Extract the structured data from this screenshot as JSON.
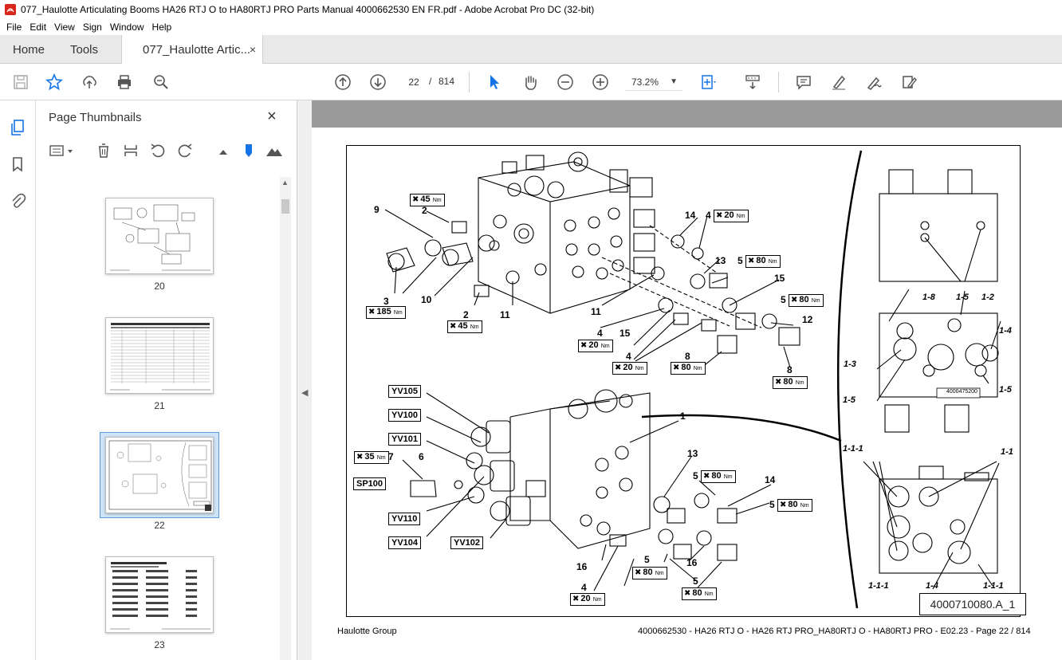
{
  "window": {
    "title": "077_Haulotte Articulating Booms HA26 RTJ O to HA80RTJ PRO Parts Manual 4000662530 EN FR.pdf - Adobe Acrobat Pro DC (32-bit)"
  },
  "menu": [
    "File",
    "Edit",
    "View",
    "Sign",
    "Window",
    "Help"
  ],
  "tabs": {
    "home": "Home",
    "tools": "Tools",
    "document": "077_Haulotte Artic...",
    "close": "×"
  },
  "toolbar": {
    "current_page": "22",
    "page_separator": "/",
    "total_pages": "814",
    "zoom": "73.2%"
  },
  "thumbnails_panel": {
    "title": "Page Thumbnails",
    "close": "×",
    "pages": [
      "20",
      "21",
      "22",
      "23"
    ],
    "selected_page": "22"
  },
  "document": {
    "footer_left": "Haulotte Group",
    "footer_right": "4000662530 - HA26 RTJ O - HA26 RTJ PRO_HA80RTJ O - HA80RTJ PRO - E02.23 - Page 22 / 814",
    "drawing_ref": "4000710080.A_1",
    "part_label": "4000475200",
    "labels": {
      "n9": "9",
      "n2a": "2",
      "n3": "3",
      "n10": "10",
      "n2b": "2",
      "n11a": "11",
      "n14a": "14",
      "n4a": "4",
      "n13a": "13",
      "n5a": "5",
      "n15a": "15",
      "n5b": "5",
      "n12": "12",
      "n11b": "11",
      "n15b": "15",
      "n4b": "4",
      "n4c": "4",
      "n8a": "8",
      "n8b": "8",
      "n1": "1",
      "n7": "7",
      "n6": "6",
      "n13b": "13",
      "n5c": "5",
      "n14b": "14",
      "n5d": "5",
      "n16a": "16",
      "n5e": "5",
      "n16b": "16",
      "n4d": "4",
      "n5f": "5"
    },
    "valves": {
      "yv105": "YV105",
      "yv100": "YV100",
      "yv101": "YV101",
      "sp100": "SP100",
      "yv110": "YV110",
      "yv104": "YV104",
      "yv102": "YV102"
    },
    "torques": {
      "t45a": "45",
      "t185": "185",
      "t45b": "45",
      "t20a": "20",
      "t80a": "80",
      "t80b": "80",
      "t20b": "20",
      "t20c": "20",
      "t80c": "80",
      "t80d": "80",
      "t35": "35",
      "t80e": "80",
      "t80f": "80",
      "t80g": "80",
      "t20d": "20",
      "t80h": "80"
    },
    "torque_unit": "Nm",
    "detail_labels": {
      "d18": "1-8",
      "d15a": "1-5",
      "d12": "1-2",
      "d14a": "1-4",
      "d13": "1-3",
      "d15b": "1-5",
      "d15c": "1-5",
      "d111a": "1-1-1",
      "d11": "1-1",
      "d111b": "1-1-1",
      "d14b": "1-4",
      "d111c": "1-1-1"
    }
  },
  "icons": {
    "app": "acrobat-icon",
    "save": "save-icon",
    "bookmark": "star-icon",
    "upload": "upload-icon",
    "print": "print-icon",
    "search": "zoom-search-icon",
    "prev_page": "arrow-up-circle-icon",
    "next_page": "arrow-down-circle-icon",
    "select": "cursor-arrow-icon",
    "hand": "hand-icon",
    "zoom_out": "zoom-out-icon",
    "zoom_in": "zoom-in-icon"
  },
  "colors": {
    "accent": "#1473e6",
    "tabbar": "#e9e9e9",
    "doc_band": "#9a9a9a",
    "selection": "#cfe4f7"
  }
}
